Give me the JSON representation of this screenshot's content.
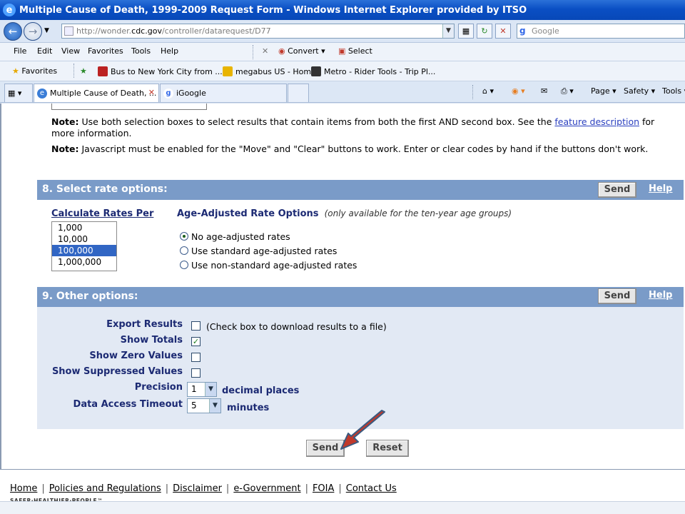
{
  "window": {
    "title": "Multiple Cause of Death, 1999-2009 Request Form - Windows Internet Explorer provided by ITSO"
  },
  "address": {
    "url_prefix": "http://wonder.",
    "url_domain": "cdc.gov",
    "url_path": "/controller/datarequest/D77",
    "search_placeholder": "Google"
  },
  "menu": {
    "items": [
      "File",
      "Edit",
      "View",
      "Favorites",
      "Tools",
      "Help"
    ],
    "convert": "Convert",
    "select": "Select"
  },
  "favorites": {
    "label": "Favorites",
    "links": [
      "Bus to New York City from ...",
      "megabus US - Home",
      "Metro - Rider Tools - Trip Pl..."
    ]
  },
  "tabs": [
    {
      "label": "Multiple Cause of Death, ..."
    },
    {
      "label": "iGoogle"
    }
  ],
  "commands": {
    "page": "Page",
    "safety": "Safety",
    "tools": "Tools"
  },
  "notes": {
    "note1_label": "Note:",
    "note1_text": "Use both selection boxes to select results that contain items from both the first AND second box. See the",
    "note1_link": "feature description",
    "note1_tail": "for more information.",
    "note2_label": "Note:",
    "note2_text": "Javascript must be enabled for the \"Move\" and \"Clear\" buttons to work. Enter or clear codes by hand if the buttons don't work."
  },
  "section8": {
    "title": "8. Select rate options:",
    "send": "Send",
    "help": "Help",
    "rates_label": "Calculate Rates Per",
    "rates_options": [
      "1,000",
      "10,000",
      "100,000",
      "1,000,000"
    ],
    "rates_selected": "100,000",
    "adj_label": "Age-Adjusted Rate Options",
    "adj_note": "(only available for the ten-year age groups)",
    "radios": [
      {
        "label": "No age-adjusted rates",
        "checked": true
      },
      {
        "label": "Use standard age-adjusted rates",
        "checked": false
      },
      {
        "label": "Use non-standard age-adjusted rates",
        "checked": false
      }
    ]
  },
  "section9": {
    "title": "9. Other options:",
    "send": "Send",
    "help": "Help",
    "export_label": "Export Results",
    "export_checked": false,
    "export_note": "(Check box to download results to a file)",
    "totals_label": "Show Totals",
    "totals_checked": true,
    "zero_label": "Show Zero Values",
    "zero_checked": false,
    "suppressed_label": "Show Suppressed Values",
    "suppressed_checked": false,
    "precision_label": "Precision",
    "precision_value": "1",
    "precision_unit": "decimal places",
    "timeout_label": "Data Access Timeout",
    "timeout_value": "5",
    "timeout_unit": "minutes"
  },
  "actions": {
    "send": "Send",
    "reset": "Reset"
  },
  "footer": {
    "links": [
      "Home",
      "Policies and Regulations",
      "Disclaimer",
      "e-Government",
      "FOIA",
      "Contact Us"
    ],
    "tagline": "SAFER·HEALTHIER·PEOPLE™"
  },
  "colors": {
    "section_header": "#7a9bc8",
    "section_bg": "#e2e9f4",
    "label_blue": "#1c2a73",
    "arrow": "#c0392b"
  }
}
